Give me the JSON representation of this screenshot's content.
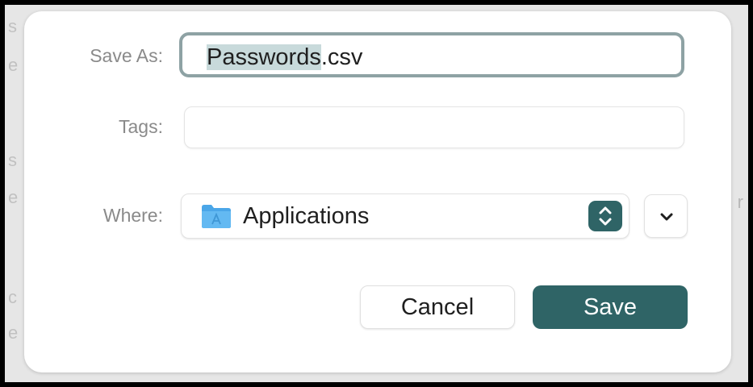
{
  "dialog": {
    "save_as": {
      "label": "Save As:",
      "filename_selected": "Passwords",
      "filename_extension": ".csv"
    },
    "tags": {
      "label": "Tags:",
      "value": ""
    },
    "where": {
      "label": "Where:",
      "location": "Applications",
      "location_icon": "folder-icon",
      "stepper_icon": "up-down-chevron-icon"
    },
    "expand_icon": "chevron-down-icon",
    "buttons": {
      "cancel": "Cancel",
      "save": "Save"
    }
  },
  "colors": {
    "accent": "#2f6466",
    "focus_ring": "#8ea2a4",
    "selection": "#c8dadb",
    "label_text": "#8a8a8a"
  }
}
